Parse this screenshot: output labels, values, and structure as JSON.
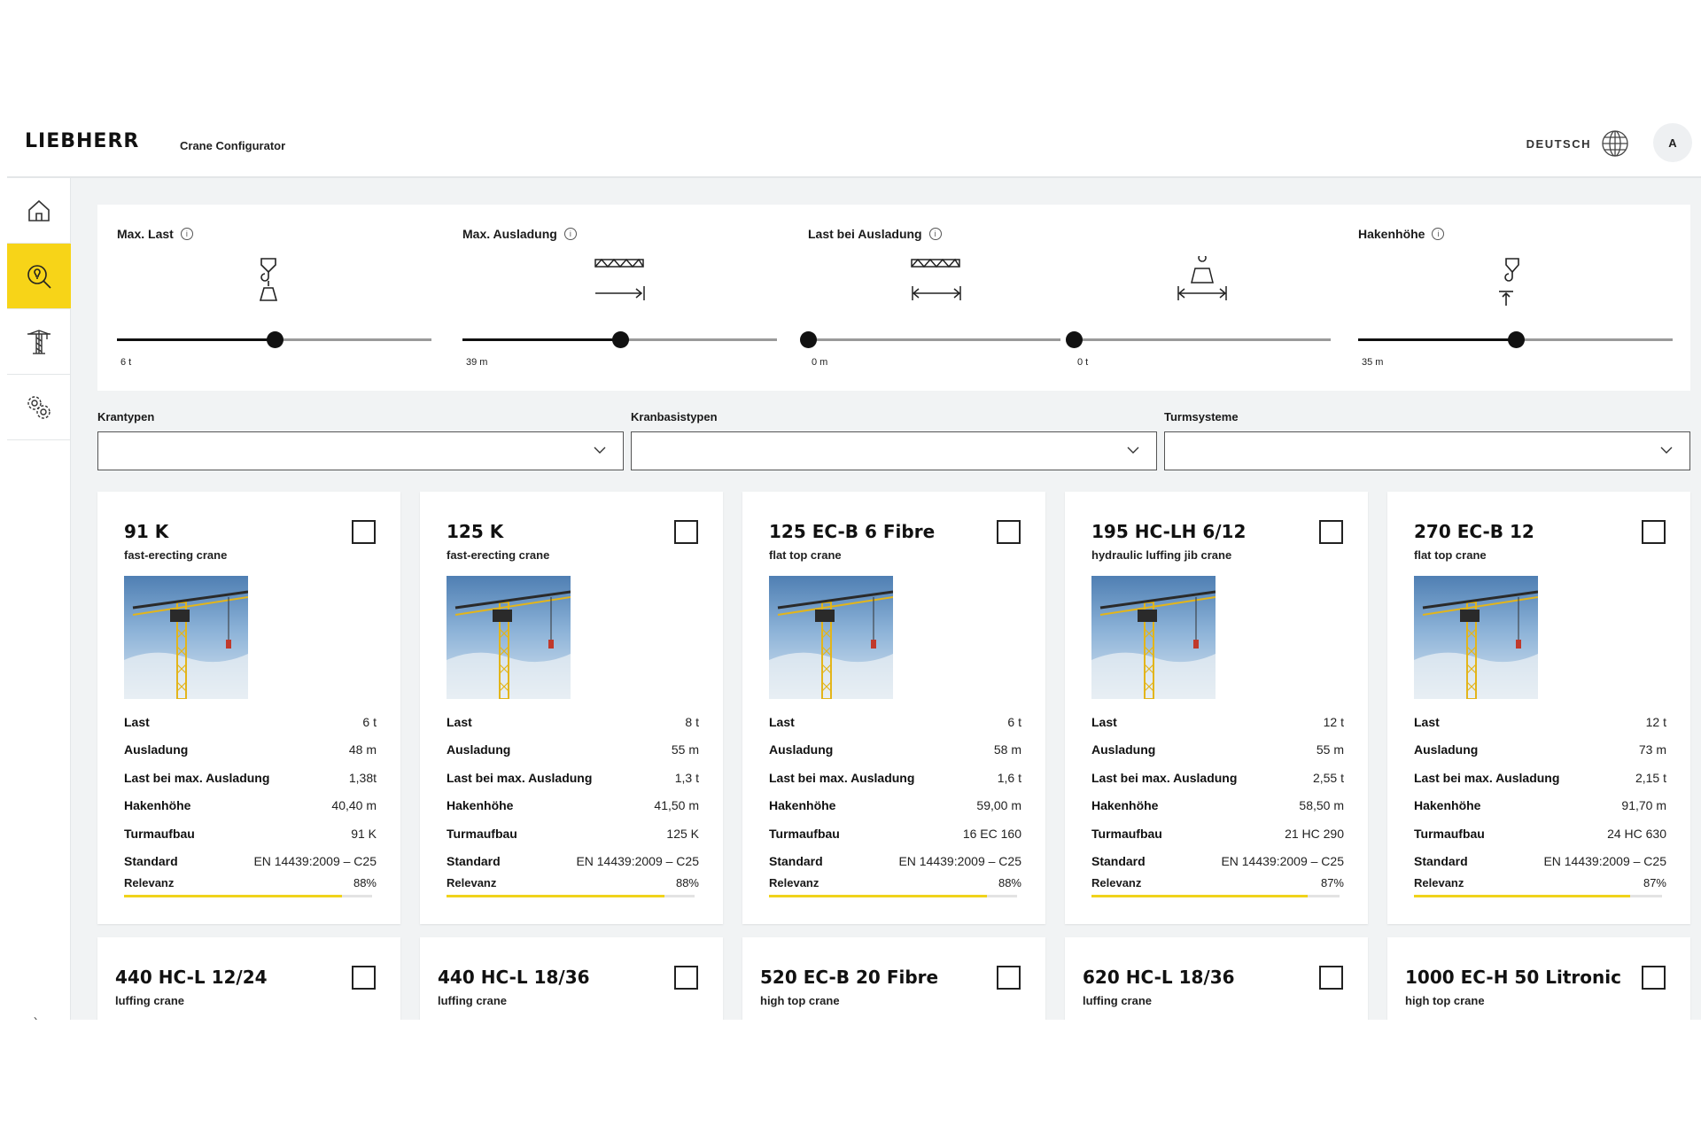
{
  "header": {
    "logo": "LIEBHERR",
    "app_title": "Crane Configurator",
    "language": "DEUTSCH",
    "avatar_initial": "A"
  },
  "sidebar": {
    "items": [
      {
        "icon": "home-icon",
        "active": false
      },
      {
        "icon": "search-bulb-icon",
        "active": true
      },
      {
        "icon": "crane-icon",
        "active": false
      },
      {
        "icon": "gears-icon",
        "active": false
      }
    ],
    "bottom_mark": "›"
  },
  "sliders": [
    {
      "label": "Max. Last",
      "value": "6 t",
      "fill": 0.5
    },
    {
      "label": "Max. Ausladung",
      "value": "39 m",
      "fill": 0.5
    },
    {
      "label": "Last bei Ausladung",
      "value_left": "0 m",
      "value_right": "0 t",
      "fill_left": 0.0,
      "fill_right": 0.0
    },
    {
      "label": "Hakenhöhe",
      "value": "35 m",
      "fill": 0.5
    }
  ],
  "filters": [
    {
      "label": "Krantypen",
      "value": ""
    },
    {
      "label": "Kranbasistypen",
      "value": ""
    },
    {
      "label": "Turmsysteme",
      "value": ""
    }
  ],
  "spec_labels": {
    "last": "Last",
    "ausladung": "Ausladung",
    "last_max": "Last bei max. Ausladung",
    "hakenhoehe": "Hakenhöhe",
    "turmaufbau": "Turmaufbau",
    "standard": "Standard",
    "relevanz": "Relevanz"
  },
  "cards": [
    {
      "title": "91 K",
      "subtitle": "fast-erecting crane",
      "last": "6 t",
      "ausladung": "48 m",
      "last_max": "1,38t",
      "hakenhoehe": "40,40 m",
      "turmaufbau": "91 K",
      "standard": "EN 14439:2009 – C25",
      "relevanz": "88%",
      "rel": 0.88
    },
    {
      "title": "125 K",
      "subtitle": "fast-erecting crane",
      "last": "8 t",
      "ausladung": "55 m",
      "last_max": "1,3 t",
      "hakenhoehe": "41,50 m",
      "turmaufbau": "125 K",
      "standard": "EN 14439:2009 – C25",
      "relevanz": "88%",
      "rel": 0.88
    },
    {
      "title": "125 EC-B 6 Fibre",
      "subtitle": "flat top crane",
      "last": "6 t",
      "ausladung": "58 m",
      "last_max": "1,6 t",
      "hakenhoehe": "59,00 m",
      "turmaufbau": "16 EC 160",
      "standard": "EN 14439:2009 – C25",
      "relevanz": "88%",
      "rel": 0.88
    },
    {
      "title": "195 HC-LH 6/12",
      "subtitle": "hydraulic luffing jib crane",
      "last": "12 t",
      "ausladung": "55 m",
      "last_max": "2,55 t",
      "hakenhoehe": "58,50 m",
      "turmaufbau": "21 HC 290",
      "standard": "EN 14439:2009 – C25",
      "relevanz": "87%",
      "rel": 0.87
    },
    {
      "title": "270 EC-B 12",
      "subtitle": "flat top crane",
      "last": "12 t",
      "ausladung": "73 m",
      "last_max": "2,15 t",
      "hakenhoehe": "91,70 m",
      "turmaufbau": "24 HC 630",
      "standard": "EN 14439:2009 – C25",
      "relevanz": "87%",
      "rel": 0.87
    }
  ],
  "cards_row2": [
    {
      "title": "440 HC-L 12/24",
      "subtitle": "luffing crane"
    },
    {
      "title": "440 HC-L 18/36",
      "subtitle": "luffing crane"
    },
    {
      "title": "520 EC-B 20 Fibre",
      "subtitle": "high top crane"
    },
    {
      "title": "620 HC-L 18/36",
      "subtitle": "luffing crane"
    },
    {
      "title": "1000 EC-H 50 Litronic",
      "subtitle": "high top crane"
    }
  ]
}
